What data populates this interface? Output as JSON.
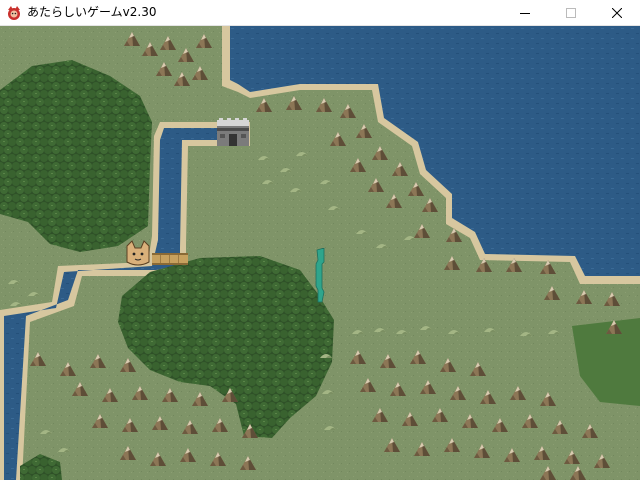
{
  "window": {
    "title": "あたらしいゲームv2.30",
    "icon": "game-app-icon",
    "controls": [
      "minimize-icon",
      "maximize-icon",
      "close-icon"
    ]
  },
  "colors": {
    "grass": "#7f9468",
    "grass_light": "#97a77a",
    "water": "#2d5b86",
    "water_dark": "#234a72",
    "shore": "#d9c9a4",
    "forest": "#355a2c",
    "mountain": "#a58e6b",
    "player": "#2fa58c",
    "cat": "#d9b07a"
  },
  "map": {
    "objects": [
      {
        "name": "player-character",
        "icon": "player-icon"
      },
      {
        "name": "cat-npc",
        "icon": "cat-face-icon"
      },
      {
        "name": "castle",
        "icon": "castle-icon"
      },
      {
        "name": "wooden-bridge",
        "icon": "bridge-icon"
      }
    ]
  }
}
